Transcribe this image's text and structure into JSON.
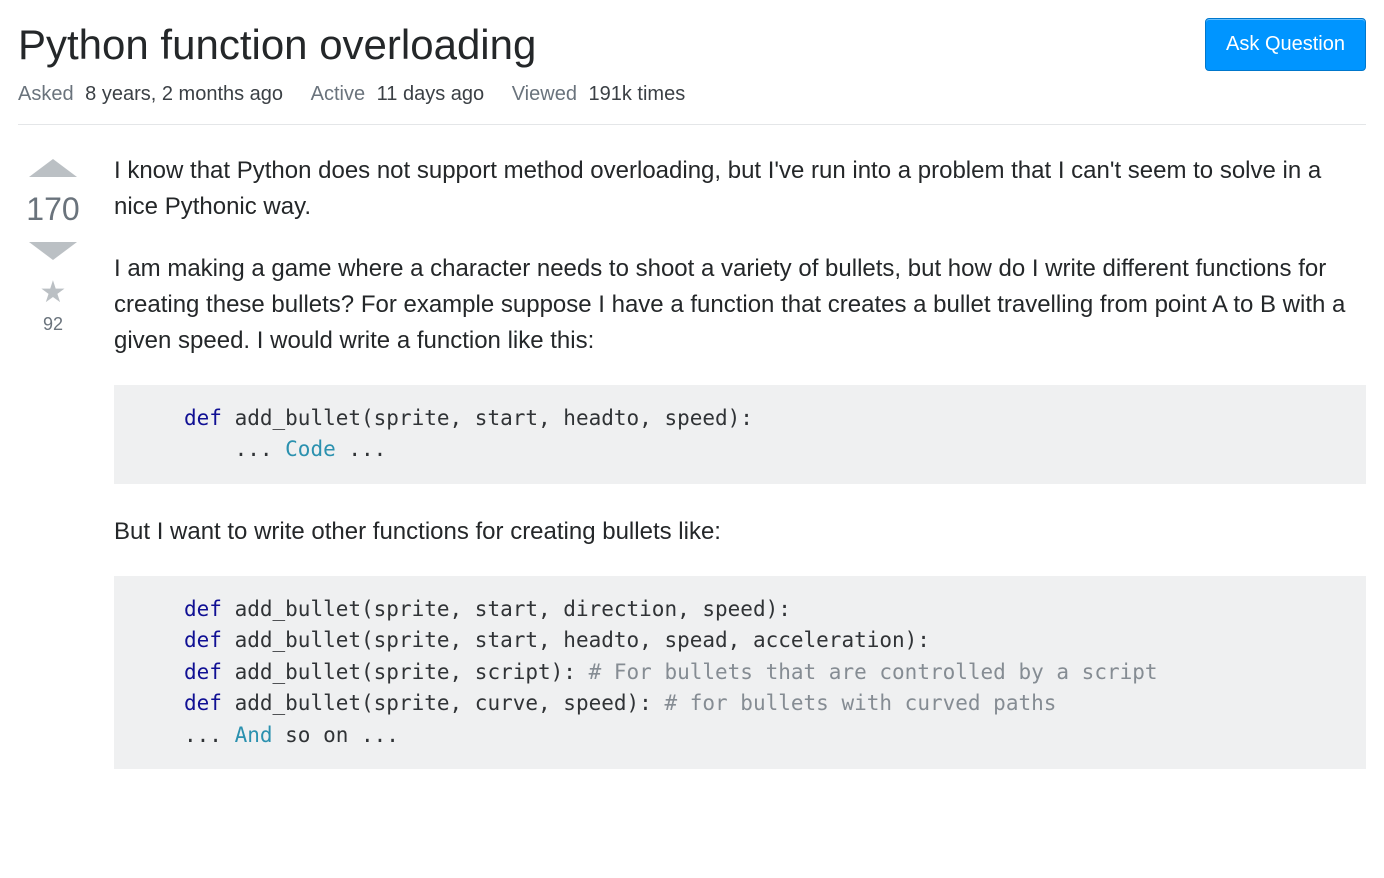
{
  "header": {
    "title": "Python function overloading",
    "ask_button": "Ask Question"
  },
  "meta": {
    "asked_label": "Asked",
    "asked_value": "8 years, 2 months ago",
    "active_label": "Active",
    "active_value": "11 days ago",
    "viewed_label": "Viewed",
    "viewed_value": "191k times"
  },
  "votes": {
    "score": "170",
    "favorites": "92"
  },
  "post": {
    "para1": "I know that Python does not support method overloading, but I've run into a problem that I can't seem to solve in a nice Pythonic way.",
    "para2": "I am making a game where a character needs to shoot a variety of bullets, but how do I write different functions for creating these bullets? For example suppose I have a function that creates a bullet travelling from point A to B with a given speed. I would write a function like this:",
    "para3": "But I want to write other functions for creating bullets like:",
    "code1": {
      "kw1": "def",
      "rest1": " add_bullet(sprite, start, headto, speed):",
      "line2a": "    ... ",
      "typ1": "Code",
      "line2b": " ..."
    },
    "code2": {
      "kw1": "def",
      "rest1": " add_bullet(sprite, start, direction, speed):",
      "kw2": "def",
      "rest2": " add_bullet(sprite, start, headto, spead, acceleration):",
      "kw3": "def",
      "rest3": " add_bullet(sprite, script): ",
      "com3": "# For bullets that are controlled by a script",
      "kw4": "def",
      "rest4": " add_bullet(sprite, curve, speed): ",
      "com4": "# for bullets with curved paths",
      "line5a": "... ",
      "typ5": "And",
      "line5b": " so on ..."
    }
  }
}
